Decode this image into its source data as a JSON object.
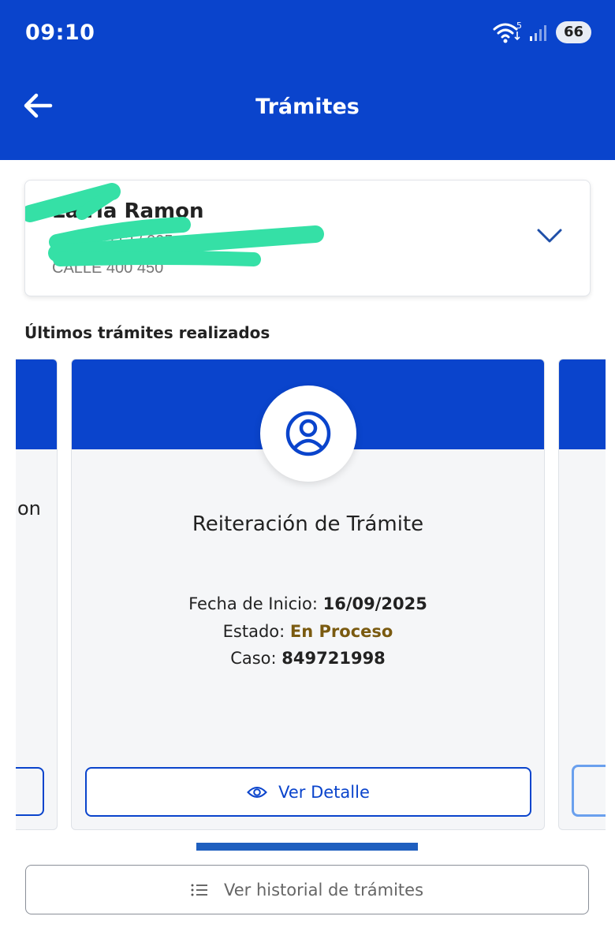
{
  "status_bar": {
    "time": "09:10",
    "battery": "66",
    "wifi_badge": "5"
  },
  "header": {
    "title": "Trámites",
    "back_icon": "arrow-left-icon"
  },
  "account": {
    "name": "La   ria Ramon",
    "number": "Cuenta     712 / 005        ",
    "address": "CALLE 400 450",
    "expand_icon": "chevron-down-icon"
  },
  "section_title": "Últimos trámites realizados",
  "cards": {
    "left_partial_text": "on",
    "main": {
      "title": "Reiteración de Trámite",
      "icon": "user-circle-icon",
      "fecha_label": "Fecha de Inicio:",
      "fecha_value": "16/09/2025",
      "estado_label": "Estado:",
      "estado_value": "En Proceso",
      "caso_label": "Caso:",
      "caso_value": "849721998",
      "button_label": "Ver Detalle",
      "button_icon": "eye-icon"
    }
  },
  "history_button": {
    "label": "Ver historial de trámites",
    "icon": "list-icon"
  },
  "colors": {
    "primary": "#0a44cc",
    "status_in_process": "#7a5a10",
    "redaction_marker": "#35e0a6"
  }
}
